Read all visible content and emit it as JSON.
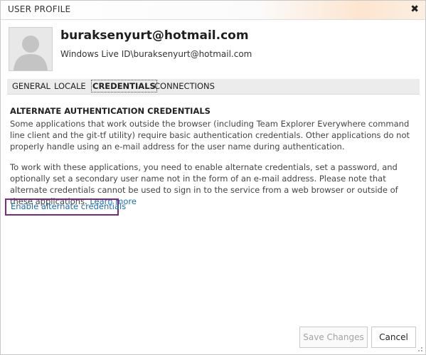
{
  "dialog": {
    "title": "USER PROFILE",
    "close_glyph": "✖"
  },
  "profile": {
    "name": "buraksenyurt@hotmail.com",
    "id": "Windows Live ID\\buraksenyurt@hotmail.com",
    "avatar_icon": "person-silhouette-icon"
  },
  "tabs": [
    {
      "label": "GENERAL",
      "active": false
    },
    {
      "label": "LOCALE",
      "active": false
    },
    {
      "label": "CREDENTIALS",
      "active": true
    },
    {
      "label": "CONNECTIONS",
      "active": false
    }
  ],
  "content": {
    "heading": "ALTERNATE AUTHENTICATION CREDENTIALS",
    "paragraph1": "Some applications that work outside the browser (including Team Explorer Everywhere command line client and the git-tf utility) require basic authentication credentials. Other applications do not properly handle using an e-mail address for the user name during authentication.",
    "paragraph2": "To work with these applications, you need to enable alternate credentials, set a password, and optionally set a secondary user name not in the form of an e-mail address. Please note that alternate credentials cannot be used to sign in to the service from a web browser or outside of these applications.",
    "learn_more": "Learn more",
    "enable_link": "Enable alternate credentials"
  },
  "footer": {
    "save_label": "Save Changes",
    "save_enabled": false,
    "cancel_label": "Cancel"
  },
  "colors": {
    "link": "#1a6fb5",
    "highlight_border": "#7a2a82",
    "title_gradient_accent": "#fde5cf"
  }
}
